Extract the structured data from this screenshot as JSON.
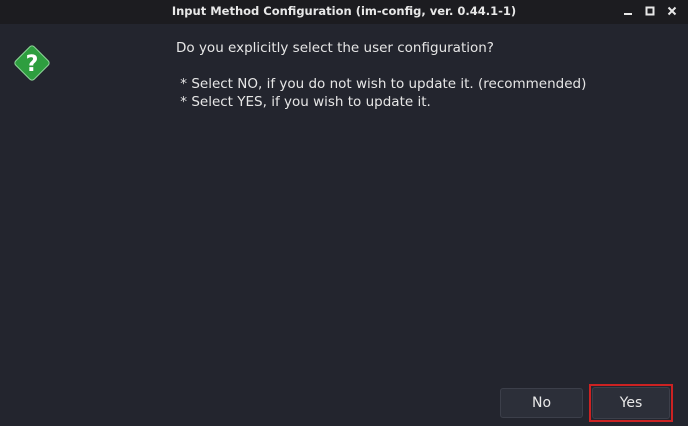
{
  "window": {
    "title": "Input Method Configuration (im-config, ver. 0.44.1-1)"
  },
  "controls": {
    "minimize_icon": "minimize-icon",
    "maximize_icon": "maximize-icon",
    "close_icon": "close-icon"
  },
  "dialog": {
    "icon": "question-icon",
    "question": "Do you explicitly select the user configuration?",
    "option_no": " * Select NO, if you do not wish to update it. (recommended)",
    "option_yes": " * Select YES, if you wish to update it."
  },
  "buttons": {
    "no_label": "No",
    "yes_label": "Yes"
  },
  "colors": {
    "background": "#23252e",
    "titlebar": "#1c1c20",
    "icon_green": "#2e9e3f",
    "highlight": "#cc2222"
  }
}
